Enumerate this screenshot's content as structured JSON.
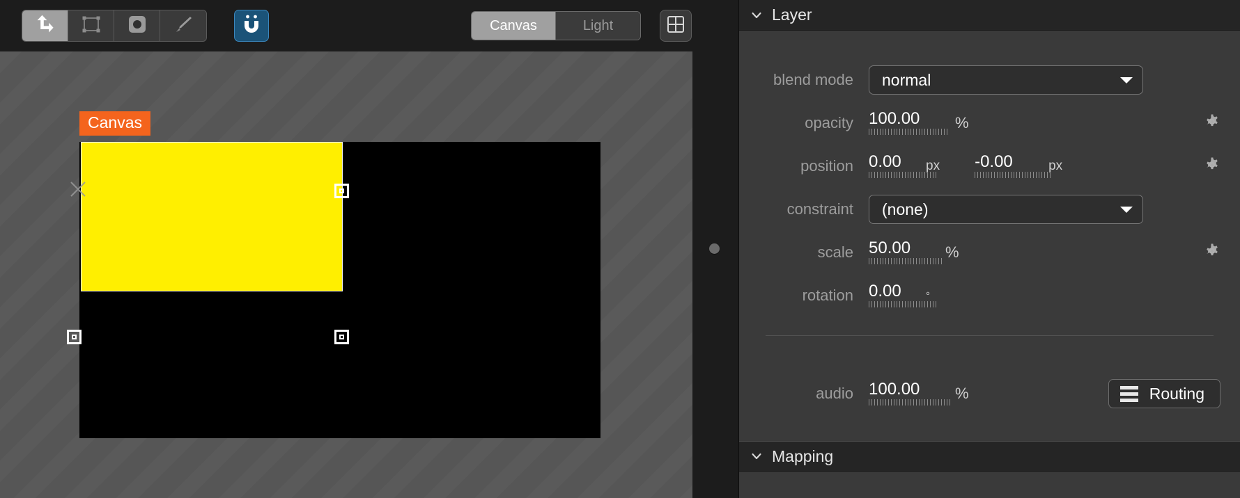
{
  "toolbar": {
    "tools": [
      {
        "name": "transform-tool",
        "icon": "transform-arrow-icon",
        "active": true
      },
      {
        "name": "select-tool",
        "icon": "bounding-box-icon",
        "active": false
      },
      {
        "name": "mask-tool",
        "icon": "rounded-square-dot-icon",
        "active": false
      },
      {
        "name": "brush-tool",
        "icon": "paintbrush-icon",
        "active": false
      }
    ],
    "magnet": {
      "label": "U",
      "icon": "magnet-icon",
      "active": true
    },
    "view_modes": [
      {
        "label": "Canvas",
        "active": true
      },
      {
        "label": "Light",
        "active": false
      }
    ],
    "grid_button": {
      "icon": "grid-2x2-icon"
    }
  },
  "viewport": {
    "layer_tag": "Canvas",
    "tag_color": "#f4641d",
    "layer_color": "#ffef00",
    "stage_color": "#000000"
  },
  "panel": {
    "sections": {
      "layer": {
        "title": "Layer",
        "collapsed": false
      },
      "mapping": {
        "title": "Mapping",
        "collapsed": false
      }
    },
    "rows": {
      "blend_mode": {
        "label": "blend mode",
        "value": "normal"
      },
      "opacity": {
        "label": "opacity",
        "value": "100.00",
        "unit": "%"
      },
      "position": {
        "label": "position",
        "x": {
          "value": "0.00",
          "unit": "px"
        },
        "y": {
          "value": "-0.00",
          "unit": "px"
        }
      },
      "constraint": {
        "label": "constraint",
        "value": "(none)"
      },
      "scale": {
        "label": "scale",
        "value": "50.00",
        "unit": "%"
      },
      "rotation": {
        "label": "rotation",
        "value": "0.00",
        "unit": "°"
      },
      "audio": {
        "label": "audio",
        "value": "100.00",
        "unit": "%",
        "routing_label": "Routing"
      }
    }
  }
}
